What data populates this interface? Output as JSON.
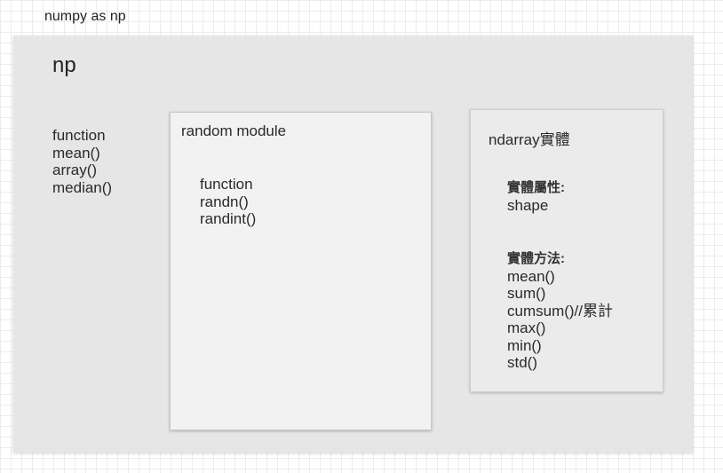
{
  "page": {
    "title": "numpy as np"
  },
  "np": {
    "title": "np",
    "items": [
      "function",
      "mean()",
      "array()",
      "median()"
    ]
  },
  "random_module": {
    "title": "random module",
    "items": [
      "function",
      "randn()",
      "randint()"
    ]
  },
  "ndarray": {
    "title": "ndarray實體",
    "attributes": {
      "heading": "實體屬性:",
      "items": [
        "shape"
      ]
    },
    "methods": {
      "heading": "實體方法:",
      "items": [
        "mean()",
        "sum()",
        "cumsum()//累計",
        "max()",
        "min()",
        "std()"
      ]
    }
  },
  "colors": {
    "outer_panel": "#e6e6e6",
    "random_box": "#f2f2f2",
    "ndarray_box": "#ebebeb",
    "grid": "#ececec",
    "text": "#2a2a2a"
  }
}
